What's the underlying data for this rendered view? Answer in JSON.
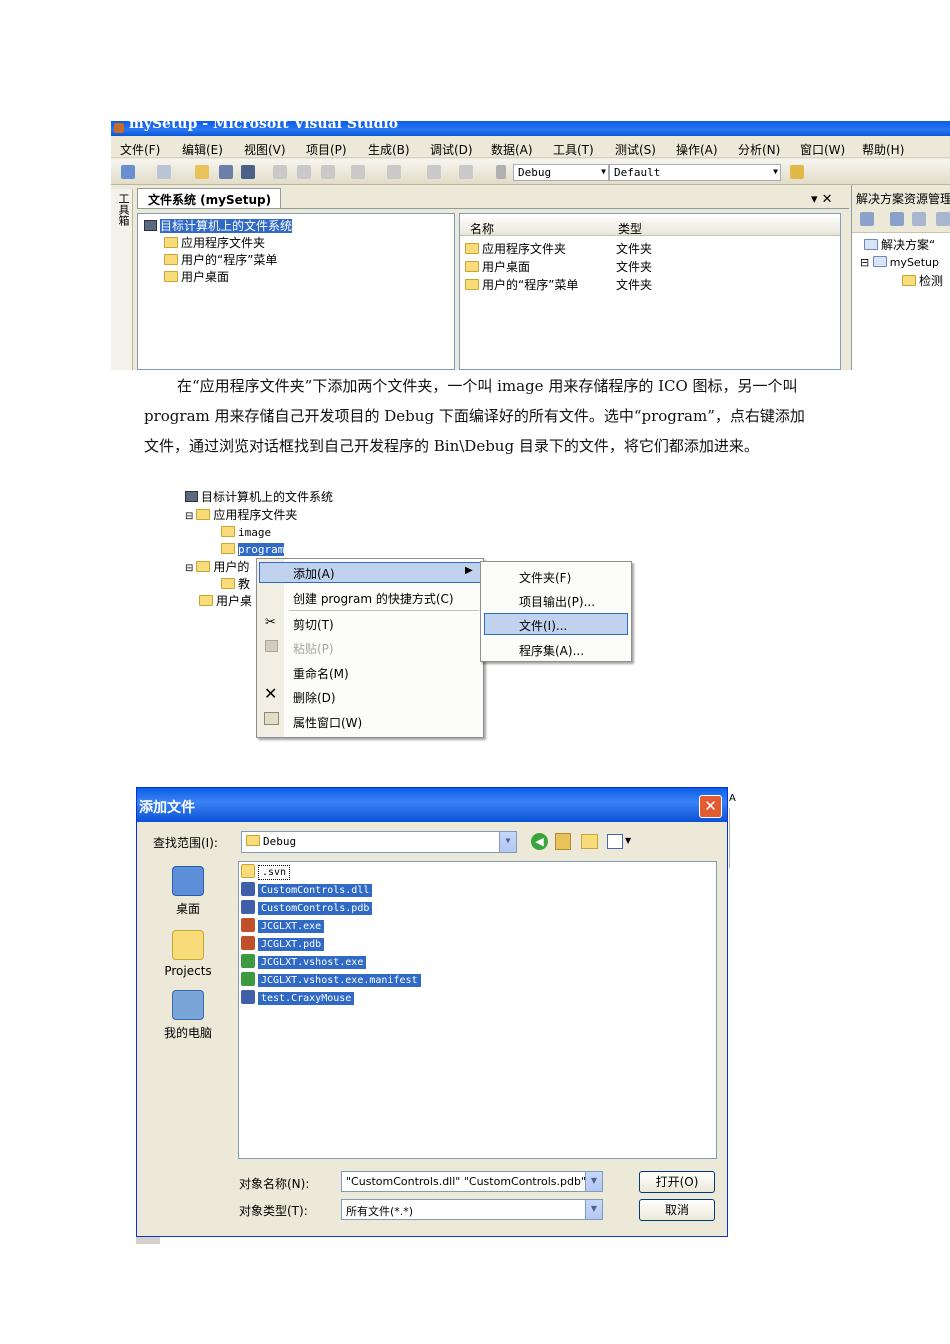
{
  "vs": {
    "title": "mySetup - Microsoft Visual Studio",
    "menus": [
      "文件(F)",
      "编辑(E)",
      "视图(V)",
      "项目(P)",
      "生成(B)",
      "调试(D)",
      "数据(A)",
      "工具(T)",
      "测试(S)",
      "操作(A)",
      "分析(N)",
      "窗口(W)",
      "帮助(H)"
    ],
    "config_combo": "Debug",
    "platform_combo": "Default",
    "toolbox_label": "工具箱",
    "doc_tab": "文件系统 (mySetup)",
    "doc_controls": "▾ ✕",
    "tree": {
      "root": "目标计算机上的文件系统",
      "items": [
        "应用程序文件夹",
        "用户的“程序”菜单",
        "用户桌面"
      ]
    },
    "list": {
      "col_name": "名称",
      "col_type": "类型",
      "rows": [
        {
          "name": "应用程序文件夹",
          "type": "文件夹"
        },
        {
          "name": "用户桌面",
          "type": "文件夹"
        },
        {
          "name": "用户的“程序”菜单",
          "type": "文件夹"
        }
      ]
    },
    "solution": {
      "title": "解决方案资源管理器",
      "root": "解决方案“",
      "project": "mySetup",
      "child": "检测"
    }
  },
  "paragraph": "在“应用程序文件夹”下添加两个文件夹，一个叫 image 用来存储程序的 ICO 图标，另一个叫 program 用来存储自己开发项目的 Debug 下面编译好的所有文件。选中“program”，点右键添加文件，通过浏览对话框找到自己开发程序的 Bin\\Debug 目录下的文件，将它们都添加进来。",
  "tree2": {
    "root": "目标计算机上的文件系统",
    "app_folder": "应用程序文件夹",
    "image": "image",
    "program": "program",
    "user_prog": "用户的",
    "teach": "教",
    "user_desk": "用户桌"
  },
  "context_menu": {
    "add": "添加(A)",
    "create_shortcut": "创建 program 的快捷方式(C)",
    "cut": "剪切(T)",
    "paste": "粘贴(P)",
    "rename": "重命名(M)",
    "delete": "删除(D)",
    "properties": "属性窗口(W)"
  },
  "submenu": {
    "folder": "文件夹(F)",
    "project_output": "项目输出(P)...",
    "file": "文件(I)...",
    "assembly": "程序集(A)..."
  },
  "dialog": {
    "title": "添加文件",
    "look_in_label": "查找范围(I):",
    "look_in_value": "Debug",
    "places": [
      "桌面",
      "Projects",
      "我的电脑"
    ],
    "files": [
      ".svn",
      "CustomControls.dll",
      "CustomControls.pdb",
      "JCGLXT.exe",
      "JCGLXT.pdb",
      "JCGLXT.vshost.exe",
      "JCGLXT.vshost.exe.manifest",
      "test.CraxyMouse"
    ],
    "filename_label": "对象名称(N):",
    "filename_value": "\"CustomControls.dll\" \"CustomControls.pdb\"",
    "filetype_label": "对象类型(T):",
    "filetype_value": "所有文件(*.*)",
    "open_button": "打开(O)",
    "cancel_button": "取消",
    "side_fragment": "A"
  }
}
